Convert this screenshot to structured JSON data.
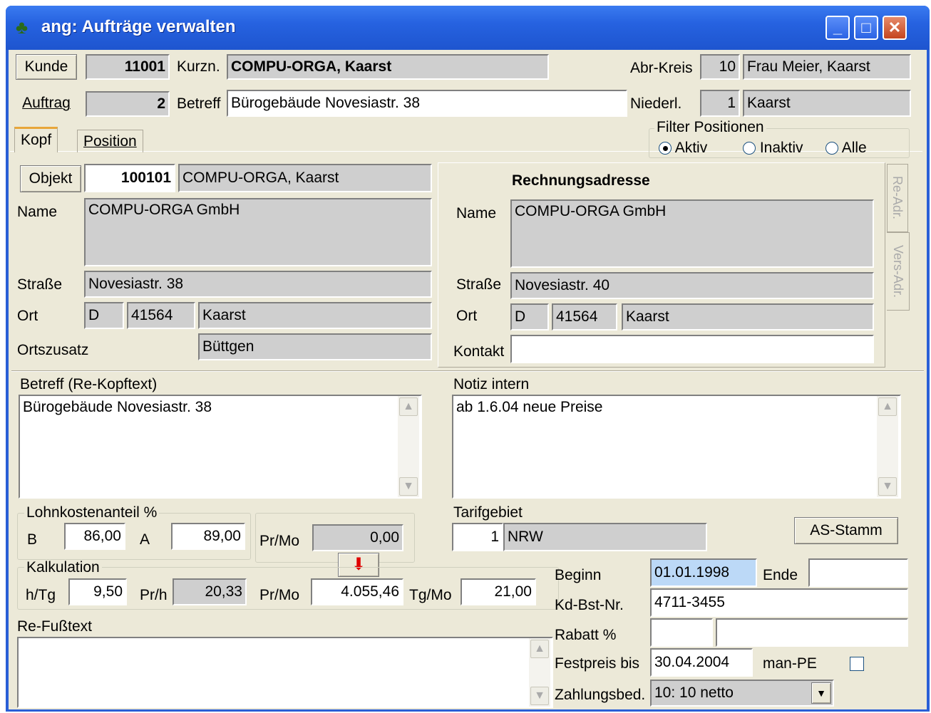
{
  "window": {
    "title": "ang: Aufträge verwalten",
    "min": "_",
    "max": "□",
    "close": "✕"
  },
  "header": {
    "kunde_btn": "Kunde",
    "kunde_nr": "11001",
    "kurzn_label": "Kurzn.",
    "kurzn_value": "COMPU-ORGA, Kaarst",
    "abrkreis_label": "Abr-Kreis",
    "abrkreis_nr": "10",
    "abrkreis_name": "Frau Meier, Kaarst",
    "auftrag_btn": "Auftrag",
    "auftrag_nr": "2",
    "betreff_label": "Betreff",
    "betreff_value": "Bürogebäude Novesiastr. 38",
    "niederl_label": "Niederl.",
    "niederl_nr": "1",
    "niederl_name": "Kaarst"
  },
  "tabs": {
    "kopf": "Kopf",
    "position": "Position"
  },
  "filter": {
    "title": "Filter Positionen",
    "aktiv": "Aktiv",
    "inaktiv": "Inaktiv",
    "alle": "Alle",
    "selected": "Aktiv"
  },
  "objekt": {
    "btn": "Objekt",
    "nr": "100101",
    "name_short": "COMPU-ORGA, Kaarst",
    "name_label": "Name",
    "name": "COMPU-ORGA GmbH",
    "strasse_label": "Straße",
    "strasse": "Novesiastr. 38",
    "ort_label": "Ort",
    "land": "D",
    "plz": "41564",
    "ort": "Kaarst",
    "ortszusatz_label": "Ortszusatz",
    "ortszusatz": "Büttgen"
  },
  "rechnung": {
    "title": "Rechnungsadresse",
    "name_label": "Name",
    "name": "COMPU-ORGA GmbH",
    "strasse_label": "Straße",
    "strasse": "Novesiastr. 40",
    "ort_label": "Ort",
    "land": "D",
    "plz": "41564",
    "ort": "Kaarst",
    "kontakt_label": "Kontakt",
    "kontakt": "",
    "side_tab1": "Re-Adr.",
    "side_tab2": "Vers-Adr."
  },
  "betreff_kopf": {
    "label": "Betreff (Re-Kopftext)",
    "text": "Bürogebäude Novesiastr. 38"
  },
  "notiz": {
    "label": "Notiz intern",
    "text": "ab 1.6.04 neue Preise"
  },
  "lohn": {
    "title": "Lohnkostenanteil %",
    "b_label": "B",
    "b": "86,00",
    "a_label": "A",
    "a": "89,00",
    "prmo_label": "Pr/Mo",
    "prmo": "0,00"
  },
  "kalk": {
    "title": "Kalkulation",
    "htg_label": "h/Tg",
    "htg": "9,50",
    "prh_label": "Pr/h",
    "prh": "20,33",
    "prmo_label": "Pr/Mo",
    "prmo": "4.055,46",
    "tgmo_label": "Tg/Mo",
    "tgmo": "21,00"
  },
  "tarif": {
    "label": "Tarifgebiet",
    "nr": "1",
    "name": "NRW",
    "as_btn": "AS-Stamm"
  },
  "details": {
    "beginn_label": "Beginn",
    "beginn": "01.01.1998",
    "ende_label": "Ende",
    "ende": "",
    "kdbst_label": "Kd-Bst-Nr.",
    "kdbst": "4711-3455",
    "rabatt_label": "Rabatt %",
    "rabatt1": "",
    "rabatt2": "",
    "festpreis_label": "Festpreis bis",
    "festpreis": "30.04.2004",
    "manpe_label": "man-PE",
    "zahlung_label": "Zahlungsbed.",
    "zahlung": "10: 10 netto"
  },
  "fusstext": {
    "label": "Re-Fußtext",
    "text": ""
  }
}
